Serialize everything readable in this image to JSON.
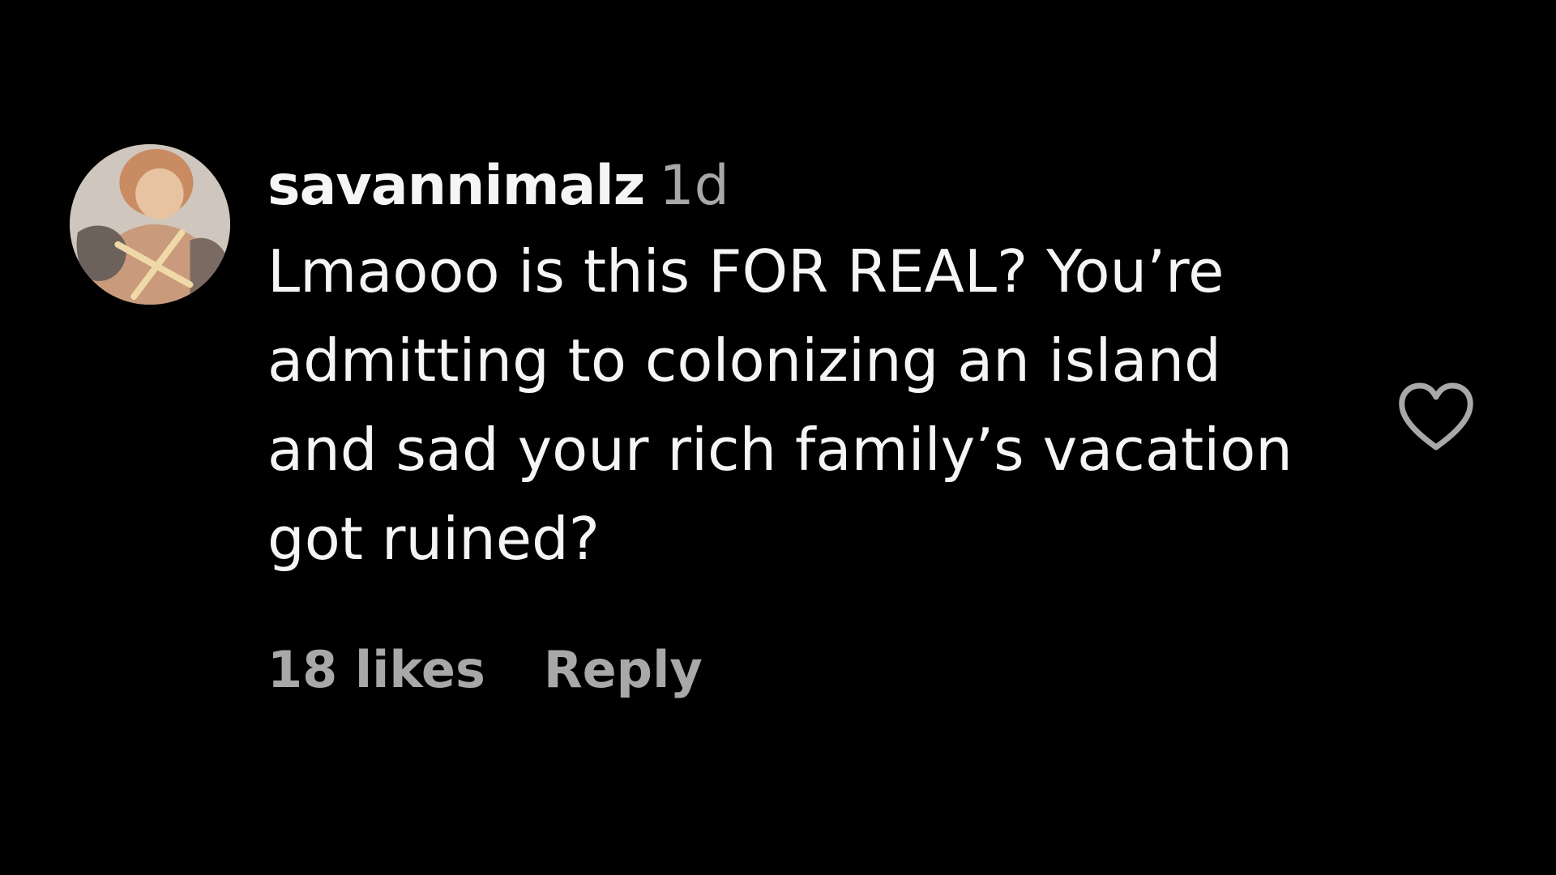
{
  "comment": {
    "username": "savannimalz",
    "time": "1d",
    "text": "Lmaooo is this FOR REAL? You’re admitting to colonizing an island and sad your rich family’s vacation got ruined?",
    "likes": "18 likes",
    "reply_label": "Reply"
  },
  "icons": {
    "like": "heart-icon",
    "avatar": "profile-photo"
  },
  "colors": {
    "background": "#000000",
    "primary_text": "#f5f5f5",
    "secondary_text": "#a8a8a8"
  }
}
